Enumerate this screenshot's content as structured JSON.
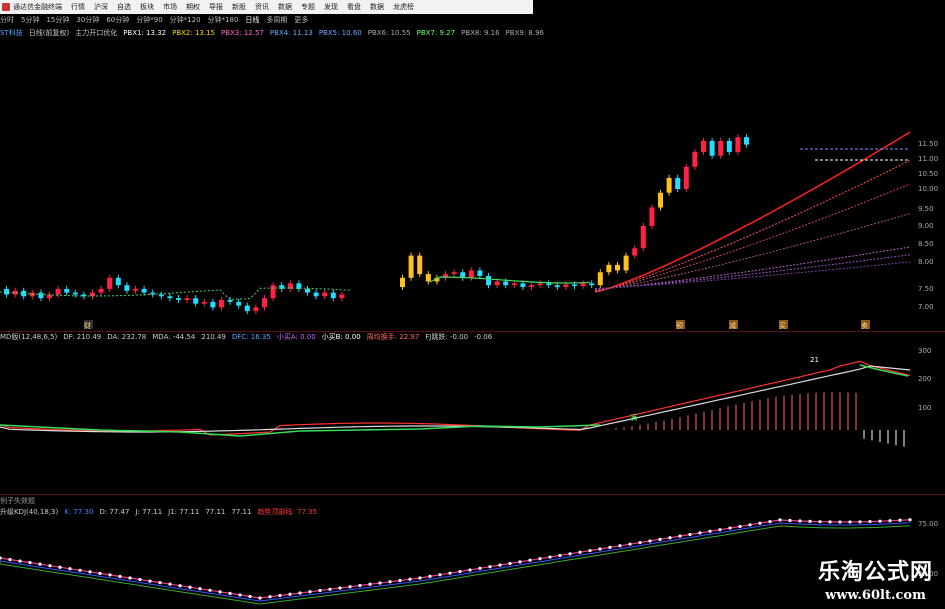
{
  "app": {
    "title": "通达信金融终端"
  },
  "menu": [
    "行情",
    "沪深",
    "自选",
    "板块",
    "市场",
    "期权",
    "导报",
    "新股",
    "资讯",
    "数据",
    "专题",
    "发现",
    "看盘",
    "数据",
    "龙虎榜"
  ],
  "periods": [
    "分时",
    "5分钟",
    "15分钟",
    "30分钟",
    "60分钟",
    "分钟*90",
    "分钟*120",
    "分钟*180",
    "日线",
    "多周期",
    "更多"
  ],
  "active_period": "日线",
  "pb_header": {
    "name": "ST科技",
    "mode": "日线(前复权)",
    "indicator": "主力开口优化",
    "pb": [
      {
        "label": "PBX1: 13.32",
        "color": "#ffffff"
      },
      {
        "label": "PBX2: 13.15",
        "color": "#ffd700"
      },
      {
        "label": "PBX3: 12.57",
        "color": "#ff66cc"
      },
      {
        "label": "PBX4: 11.13",
        "color": "#6fa8ff"
      },
      {
        "label": "PBX5: 10.60",
        "color": "#6fa8ff"
      },
      {
        "label": "PBX6: 10.55",
        "color": "#aaaaaa"
      },
      {
        "label": "PBX7: 9.27",
        "color": "#66ff66"
      },
      {
        "label": "PBX8: 9.16",
        "color": "#aaaaaa"
      },
      {
        "label": "PBX9: 8.96",
        "color": "#aaaaaa"
      }
    ]
  },
  "macd_header": [
    {
      "label": "MD版(12,48,6,5)",
      "color": "#cccccc"
    },
    {
      "label": "DF: 210.49",
      "color": "#cccccc"
    },
    {
      "label": "DA: 232.78",
      "color": "#cccccc"
    },
    {
      "label": "MDA: -44.54",
      "color": "#cccccc"
    },
    {
      "label": "210.49",
      "color": "#cccccc"
    },
    {
      "label": "DFC: 16.35",
      "color": "#4fa3ff"
    },
    {
      "label": "小买A: 0.00",
      "color": "#cc66ff"
    },
    {
      "label": "小买B: 0.00",
      "color": "#ffffff"
    },
    {
      "label": "周均换手: 22.97",
      "color": "#ff6666"
    },
    {
      "label": "FJ跳跌: -0.00",
      "color": "#cccccc"
    },
    {
      "label": "-0.06",
      "color": "#cccccc"
    }
  ],
  "kdj_caption": "例子失效题",
  "kdj_header": [
    {
      "label": "升级KDJ(40,18,3)",
      "color": "#cccccc"
    },
    {
      "label": "K: 77.30",
      "color": "#4f7fff"
    },
    {
      "label": "D: 77.47",
      "color": "#cccccc"
    },
    {
      "label": "J: 77.11",
      "color": "#cccccc"
    },
    {
      "label": "J1: 77.11",
      "color": "#cccccc"
    },
    {
      "label": "77.11",
      "color": "#cccccc"
    },
    {
      "label": "77.11",
      "color": "#cccccc"
    },
    {
      "label": "趋势顶部线: 77.35",
      "color": "#ff3333"
    }
  ],
  "price_axis": [
    "11.50",
    "11.00",
    "10.50",
    "10.00",
    "9.50",
    "9.00",
    "8.50",
    "8.00",
    "7.50",
    "7.00"
  ],
  "macd_axis": [
    "300",
    "200",
    "100"
  ],
  "kdj_axis": [
    "75.00",
    "25.00"
  ],
  "bottom_markers": [
    "财",
    "预",
    "减",
    "买",
    "卖"
  ],
  "macd_markers": [
    "21",
    "满"
  ],
  "watermark": {
    "line1": "乐淘公式网",
    "line2": "www.60lt.com"
  },
  "colors": {
    "up": "#ff2244",
    "down": "#22ddff",
    "yellow": "#ffc020",
    "separator": "#5a1010"
  }
}
